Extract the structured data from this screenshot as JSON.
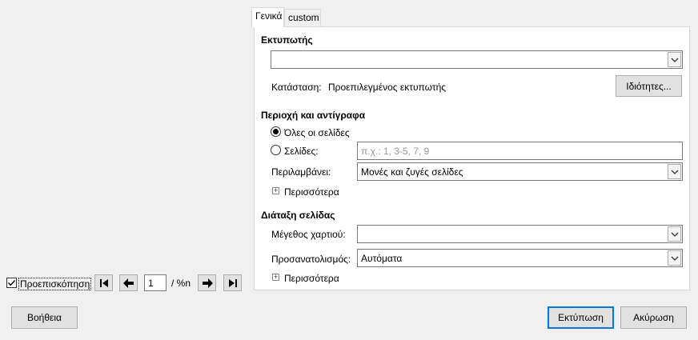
{
  "tabs": [
    {
      "label": "Γενικά"
    },
    {
      "label": "custom"
    }
  ],
  "printer": {
    "section_title": "Εκτυπωτής",
    "selected_printer": "",
    "status_label": "Κατάσταση:",
    "status_value": "Προεπιλεγμένος εκτυπωτής",
    "properties_button": "Ιδιότητες..."
  },
  "range": {
    "section_title": "Περιοχή και αντίγραφα",
    "all_pages_label": "Όλες οι σελίδες",
    "pages_label": "Σελίδες:",
    "pages_placeholder": "π.χ.: 1, 3-5, 7, 9",
    "includes_label": "Περιλαμβάνει:",
    "includes_value": "Μονές και ζυγές σελίδες",
    "more_label": "Περισσότερα"
  },
  "layout": {
    "section_title": "Διάταξη σελίδας",
    "paper_size_label": "Μέγεθος χαρτιού:",
    "paper_size_value": "",
    "orientation_label": "Προσανατολισμός:",
    "orientation_value": "Αυτόματα",
    "more_label": "Περισσότερα"
  },
  "preview": {
    "checkbox_label": "Προεπισκόπηση",
    "checked": true,
    "page_value": "1",
    "page_total": "/ %n"
  },
  "footer": {
    "help_button": "Βοήθεια",
    "print_button": "Εκτύπωση",
    "cancel_button": "Ακύρωση"
  }
}
